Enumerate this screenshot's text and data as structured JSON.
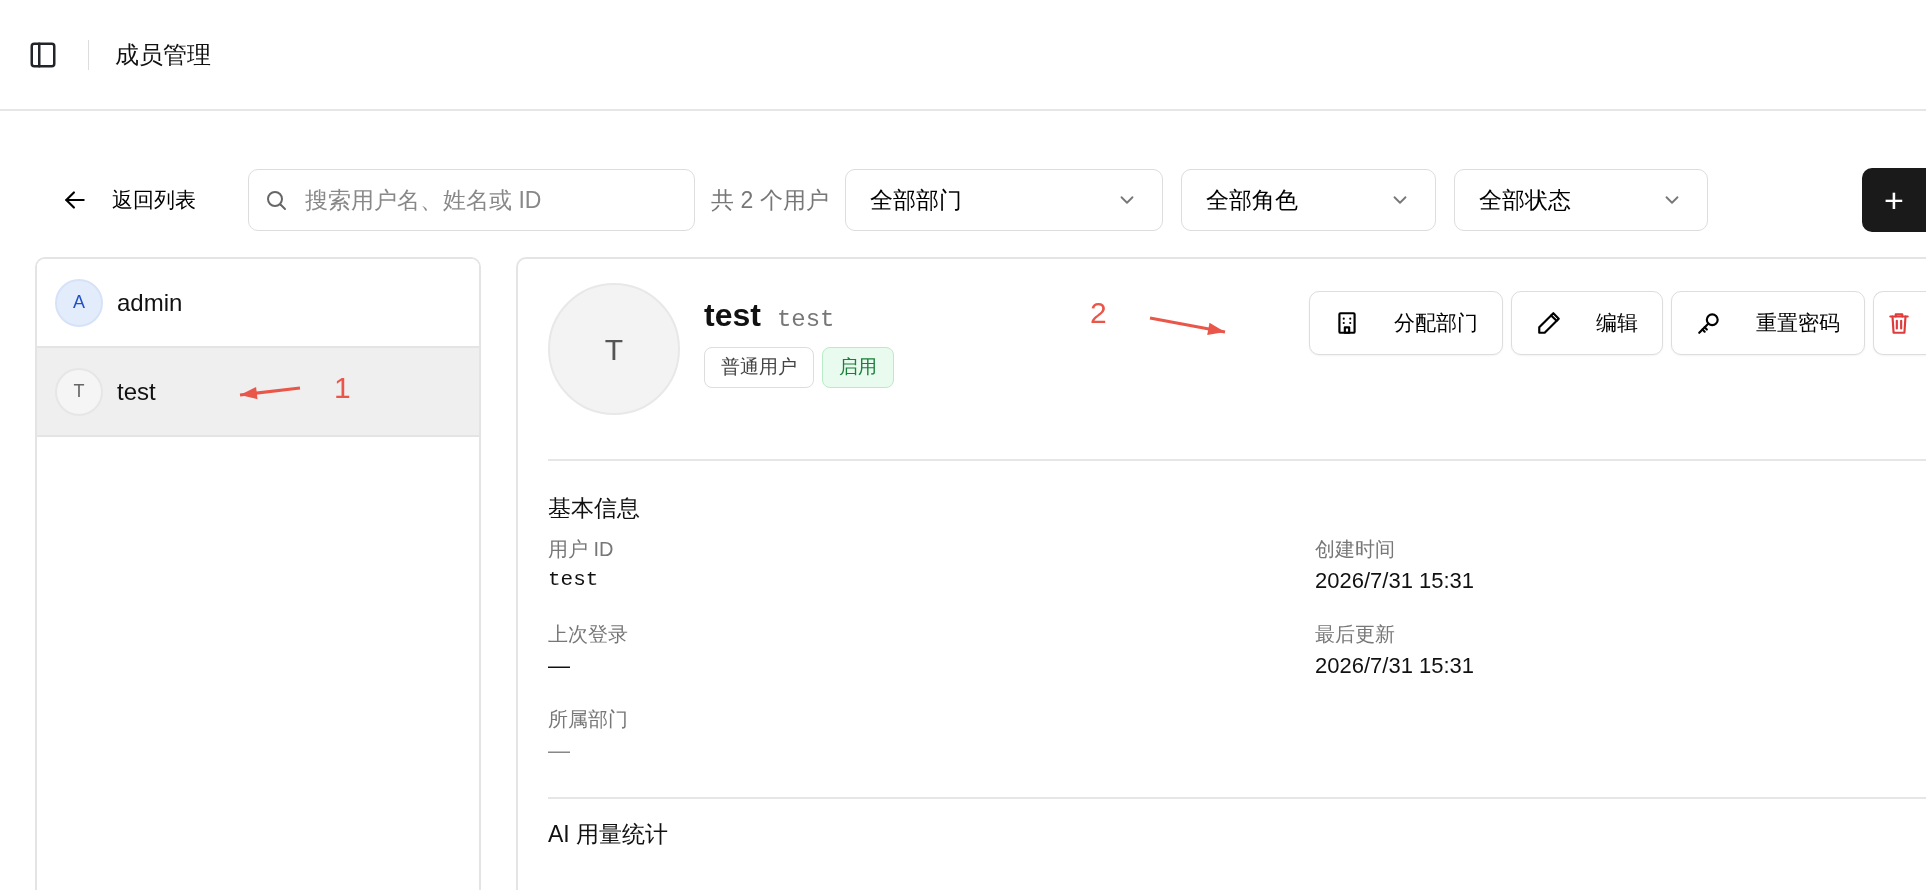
{
  "header": {
    "title": "成员管理"
  },
  "toolbar": {
    "back_label": "返回列表",
    "search": {
      "placeholder": "搜索用户名、姓名或 ID"
    },
    "count": "共 2 个用户",
    "filters": [
      {
        "value": "全部部门"
      },
      {
        "value": "全部角色"
      },
      {
        "value": "全部状态"
      }
    ],
    "add_button": {
      "label": "+"
    }
  },
  "users": [
    {
      "initial": "A",
      "name": "admin",
      "kind": "admin",
      "selected": false
    },
    {
      "initial": "T",
      "name": "test",
      "kind": "user",
      "selected": true
    }
  ],
  "detail": {
    "initial": "T",
    "name": "test",
    "username": "test",
    "tags": [
      {
        "label": "普通用户",
        "kind": "role"
      },
      {
        "label": "启用",
        "kind": "status"
      }
    ],
    "actions": [
      {
        "kind": "department",
        "label": "分配部门"
      },
      {
        "kind": "edit",
        "label": "编辑"
      },
      {
        "kind": "key",
        "label": "重置密码"
      },
      {
        "kind": "delete"
      }
    ],
    "sections": [
      {
        "title": "基本信息",
        "fields": [
          {
            "label": "用户 ID",
            "value": "test",
            "kind": "mono"
          },
          {
            "label": "创建时间",
            "value": "2026/7/31 15:31",
            "kind": "text"
          },
          {
            "label": "上次登录",
            "value": "—",
            "kind": "text"
          },
          {
            "label": "最后更新",
            "value": "2026/7/31 15:31",
            "kind": "text"
          },
          {
            "label": "所属部门",
            "value": "—",
            "kind": "muted"
          }
        ]
      },
      {
        "title": "AI 用量统计"
      }
    ]
  },
  "annotations": [
    {
      "label": "1"
    },
    {
      "label": "2"
    }
  ]
}
